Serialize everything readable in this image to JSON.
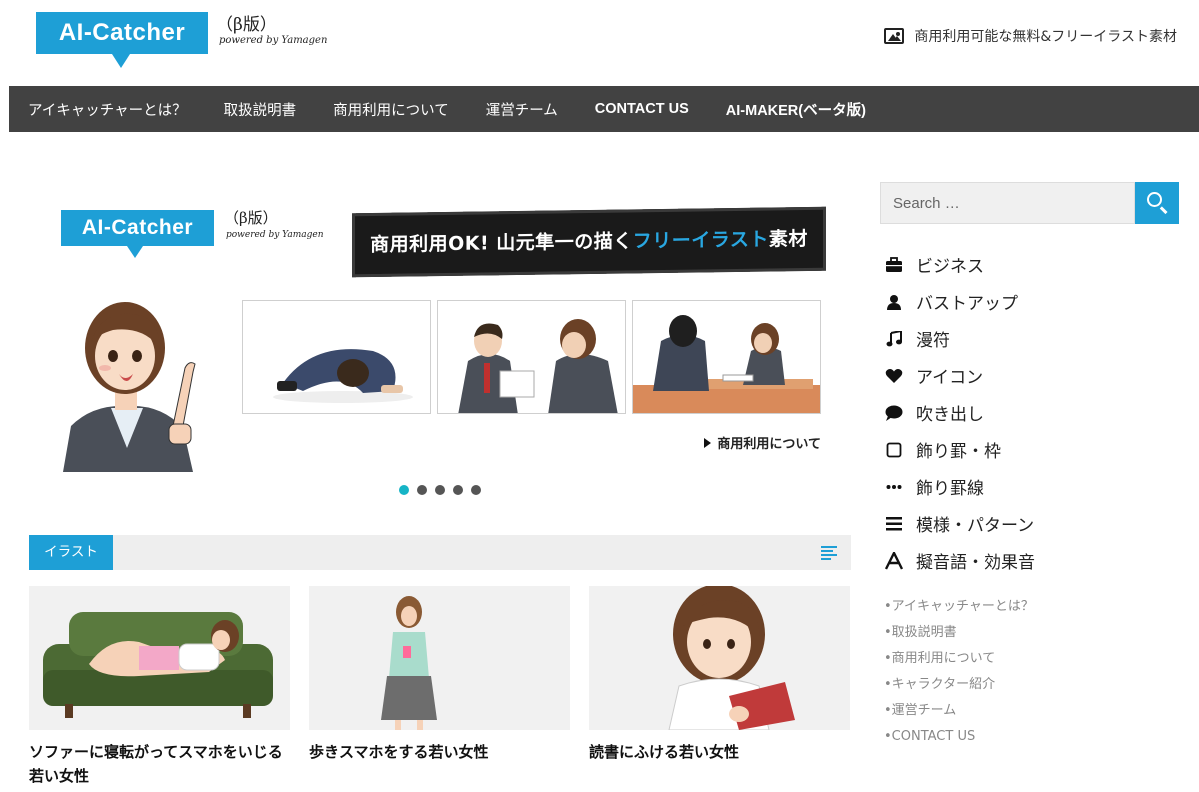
{
  "header": {
    "logo_text": "AI-Catcher",
    "logo_beta": "（β版）",
    "logo_powered": "powered by Yamagen",
    "tagline": "商用利用可能な無料&フリーイラスト素材"
  },
  "nav": {
    "items": [
      {
        "label": "アイキャッチャーとは？"
      },
      {
        "label": "取扱説明書"
      },
      {
        "label": "商用利用について"
      },
      {
        "label": "運営チーム"
      },
      {
        "label": "CONTACT US"
      },
      {
        "label": "AI-MAKER(ベータ版)"
      }
    ]
  },
  "hero": {
    "logo_text": "AI-Catcher",
    "logo_beta": "（β版）",
    "logo_powered": "powered by Yamagen",
    "banner_pre": "商用利用OK! 山元隼一の描く",
    "banner_hl": "フリーイラスト",
    "banner_post": "素材",
    "link": "商用利用について",
    "slide_count": 5,
    "active_slide": 1
  },
  "section": {
    "tab": "イラスト"
  },
  "cards": [
    {
      "title": "ソファーに寝転がってスマホをいじる若い女性"
    },
    {
      "title": "歩きスマホをする若い女性"
    },
    {
      "title": "読書にふける若い女性"
    }
  ],
  "sidebar": {
    "search_placeholder": "Search …",
    "categories": [
      {
        "label": "ビジネス",
        "icon": "briefcase-icon"
      },
      {
        "label": "バストアップ",
        "icon": "user-icon"
      },
      {
        "label": "漫符",
        "icon": "music-note-icon"
      },
      {
        "label": "アイコン",
        "icon": "heart-icon"
      },
      {
        "label": "吹き出し",
        "icon": "speech-bubble-icon"
      },
      {
        "label": "飾り罫・枠",
        "icon": "square-icon"
      },
      {
        "label": "飾り罫線",
        "icon": "dots-icon"
      },
      {
        "label": "模様・パターン",
        "icon": "list-icon"
      },
      {
        "label": "擬音語・効果音",
        "icon": "font-icon"
      }
    ],
    "links": [
      {
        "label": "•アイキャッチャーとは？"
      },
      {
        "label": "•取扱説明書"
      },
      {
        "label": "•商用利用について"
      },
      {
        "label": "•キャラクター紹介"
      },
      {
        "label": "•運営チーム"
      },
      {
        "label": "•CONTACT US"
      }
    ]
  },
  "colors": {
    "accent": "#1e9fd6",
    "nav_bg": "#424242",
    "active_dot": "#16b4c6"
  }
}
